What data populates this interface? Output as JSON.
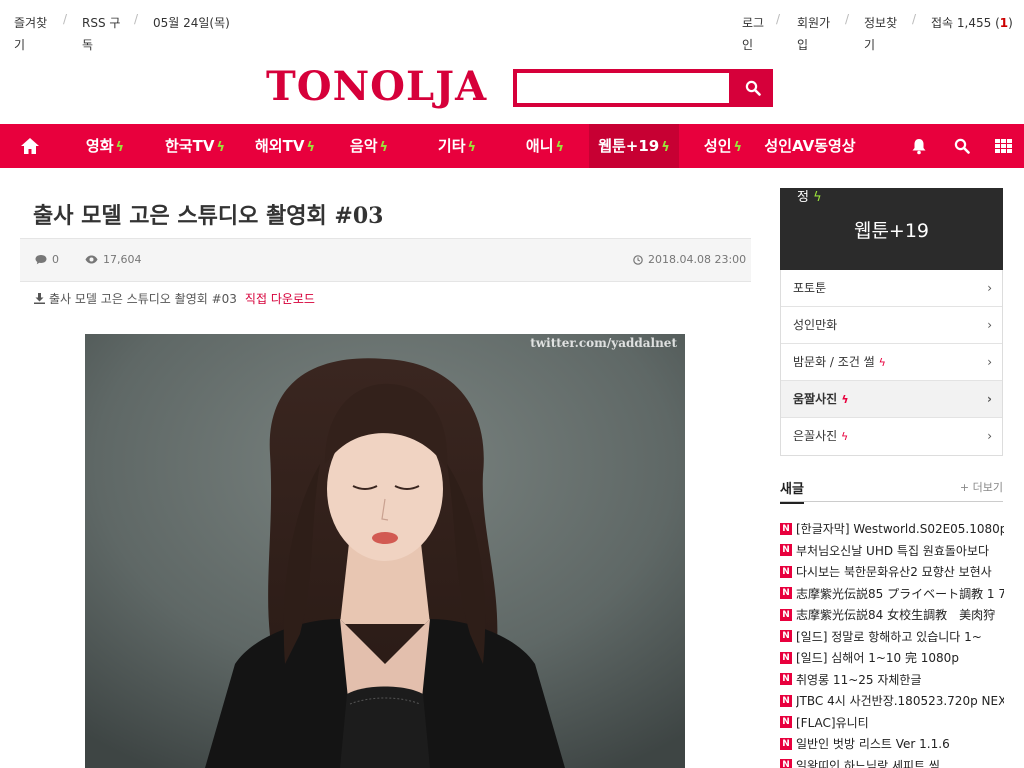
{
  "topbar": {
    "left": [
      "즐겨찾기",
      "RSS 구독",
      "05월 24일(목)"
    ],
    "right": [
      "로그인",
      "회원가입",
      "정보찾기"
    ],
    "connections_label": "접속 1,455",
    "connections_new": "1"
  },
  "logo": "TONOLJA",
  "search": {
    "value": ""
  },
  "nav": {
    "items": [
      {
        "label": "영화",
        "bolt": true
      },
      {
        "label": "한국TV",
        "bolt": true
      },
      {
        "label": "해외TV",
        "bolt": true
      },
      {
        "label": "음악",
        "bolt": true
      },
      {
        "label": "기타",
        "bolt": true
      },
      {
        "label": "애니",
        "bolt": true
      },
      {
        "label": "웹툰+19",
        "bolt": true,
        "active": true
      },
      {
        "label": "성인",
        "bolt": true
      },
      {
        "label": "성인AV동영상",
        "bolt": false
      }
    ]
  },
  "post": {
    "title": "출사 모델 고은 스튜디오 촬영회 #03",
    "comments": "0",
    "views": "17,604",
    "datetime": "2018.04.08 23:00",
    "download_name": "출사 모델 고은 스튜디오 촬영회 #03",
    "download_direct": "직접 다운로드",
    "watermark": "twitter.com/yaddalnet"
  },
  "sidebar": {
    "box_tag": "정",
    "box_title": "웹툰+19",
    "items": [
      {
        "label": "포토툰",
        "bolt": false
      },
      {
        "label": "성인만화",
        "bolt": false
      },
      {
        "label": "밤문화 / 조건 썰",
        "bolt": true
      },
      {
        "label": "움짤사진",
        "bolt": true,
        "active": true
      },
      {
        "label": "은꼴사진",
        "bolt": true
      }
    ]
  },
  "new_posts": {
    "title": "새글",
    "more": "+ 더보기",
    "items": [
      "[한글자막] Westworld.S02E05.1080p.",
      "부처님오신날 UHD 특집 원효돌아보다",
      "다시보는 북한문화유산2 묘향산 보현사",
      "志摩紫光伝説85 プライベート調教 1 7",
      "志摩紫光伝説84 女校生調教　美肉狩",
      "[일드] 정말로 항해하고 있습니다 1~",
      "[일드] 심해어 1~10 完 1080p",
      "취영롱 11~25 자체한글",
      "JTBC 4시 사건반장.180523.720p NEX",
      "[FLAC]유니티",
      "일반인 벗방 리스트 Ver 1.1.6",
      "일왕띠인 하느님랑 세피트 씩"
    ]
  },
  "colors": {
    "brand": "#e8003d",
    "bolt": "#9be33a"
  }
}
